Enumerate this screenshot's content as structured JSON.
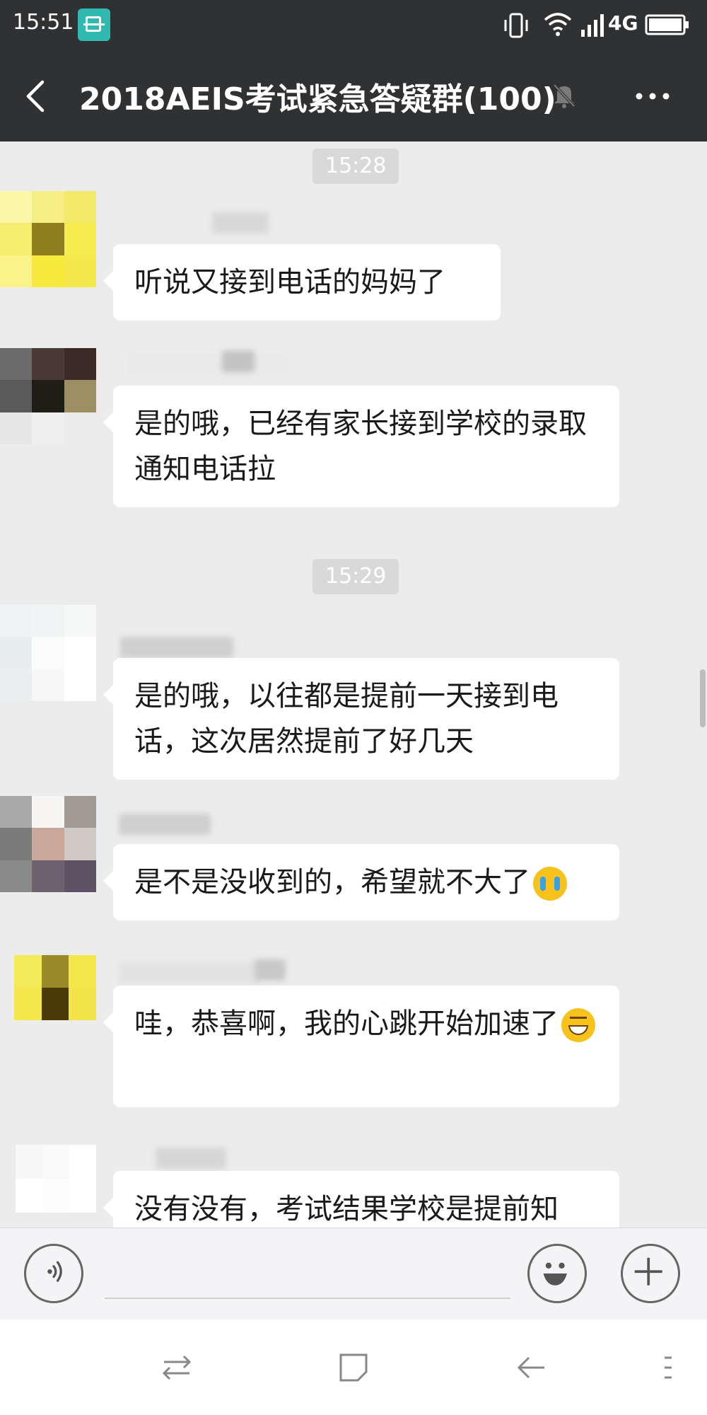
{
  "status_bar": {
    "time": "15:51",
    "network": "4G",
    "icons": [
      "scan-icon",
      "vibrate-icon",
      "wifi-icon",
      "signal-icon",
      "battery-icon"
    ]
  },
  "header": {
    "title": "2018AEIS考试紧急答疑群(100)",
    "icons": [
      "back-icon",
      "mute-icon",
      "more-icon"
    ]
  },
  "chat": {
    "timestamps": [
      "15:28",
      "15:29"
    ],
    "messages": [
      {
        "text": "听说又接到电话的妈妈了",
        "sender_hidden": true
      },
      {
        "text": "是的哦，已经有家长接到学校的录取通知电话拉",
        "sender_hidden": true
      },
      {
        "text": "是的哦，以往都是提前一天接到电话，这次居然提前了好几天",
        "sender_hidden": true
      },
      {
        "text": "是不是没收到的，希望就不大了",
        "emoji": "crying-face-emoji",
        "sender_hidden": true
      },
      {
        "text": "哇，恭喜啊，我的心跳开始加速了",
        "emoji": "grinning-face-emoji",
        "sender_hidden": true
      },
      {
        "text": "没有没有，考试结果学校是提前知",
        "sender_hidden": true
      }
    ]
  },
  "input_bar": {
    "placeholder": "",
    "icons": [
      "voice-icon",
      "smiley-icon",
      "plus-icon"
    ]
  },
  "nav_bar": {
    "icons": [
      "switch-icon",
      "home-icon",
      "back-nav-icon",
      "menu-icon"
    ]
  },
  "colors": {
    "top_bar": "#2f3133",
    "chat_background": "#ececec",
    "bubble": "#ffffff",
    "timestamp_chip": "#d9d9d9"
  }
}
